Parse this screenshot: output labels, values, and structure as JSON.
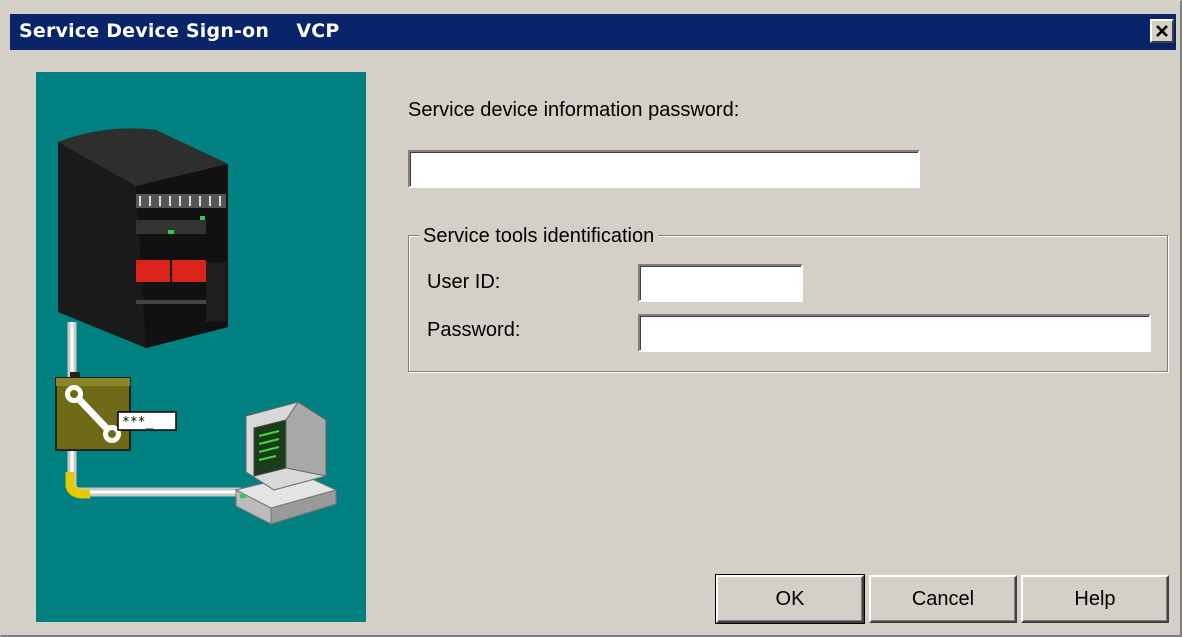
{
  "window": {
    "title": "Service Device Sign-on    VCP",
    "close_icon": "close-icon"
  },
  "illustration": {
    "background_color": "#008080",
    "server_icon": "server-tower-icon",
    "toolbox_icon": "wrench-toolbox-icon",
    "password_prompt_text": "***_",
    "workstation_icon": "computer-workstation-icon"
  },
  "form": {
    "device_password_label": "Service device information password:",
    "device_password_value": "",
    "group_title": "Service tools identification",
    "user_id_label": "User ID:",
    "user_id_value": "",
    "password_label": "Password:",
    "password_value": ""
  },
  "buttons": {
    "ok": "OK",
    "cancel": "Cancel",
    "help": "Help"
  }
}
